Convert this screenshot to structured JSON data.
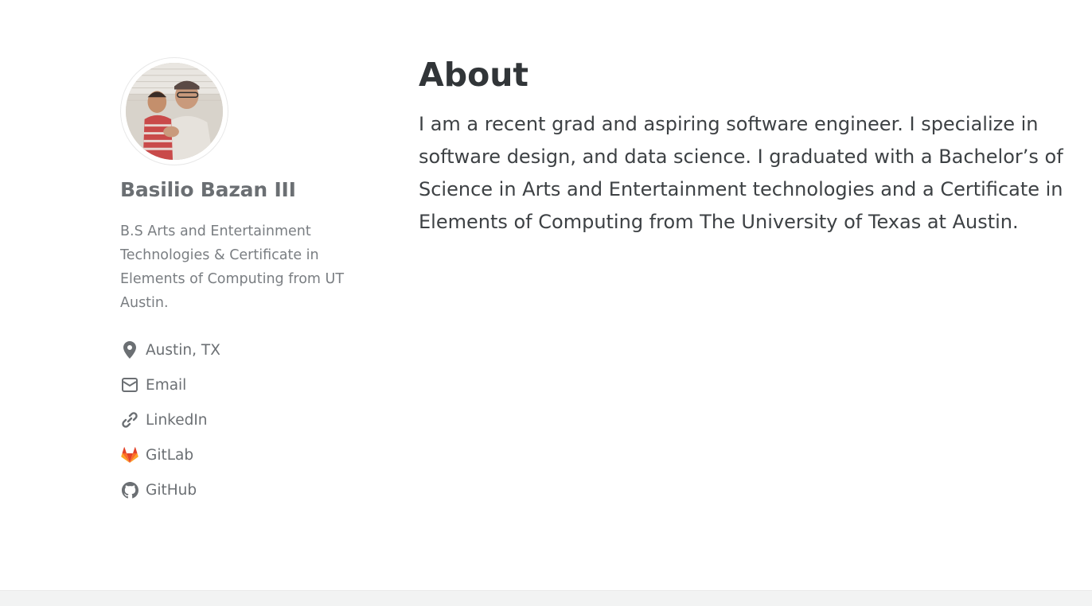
{
  "author": {
    "name": "Basilio Bazan III",
    "bio": "B.S Arts and Entertainment Technologies & Certificate in Elements of Computing from UT Austin.",
    "avatar_icon": "profile-photo"
  },
  "links": [
    {
      "label": "Austin, TX",
      "icon": "map-marker-icon"
    },
    {
      "label": "Email",
      "icon": "envelope-icon"
    },
    {
      "label": "LinkedIn",
      "icon": "link-icon"
    },
    {
      "label": "GitLab",
      "icon": "gitlab-icon"
    },
    {
      "label": "GitHub",
      "icon": "github-icon"
    }
  ],
  "main": {
    "title": "About",
    "body": "I am a recent grad and aspiring software engineer. I specialize in software design, and data science. I graduated with a Bachelor’s of Science in Arts and Entertainment technologies and a Certificate in Elements of Computing from The University of Texas at Austin."
  },
  "colors": {
    "text": "#494e52",
    "gitlab": "#e24329",
    "footer_bg": "#f2f3f3"
  }
}
